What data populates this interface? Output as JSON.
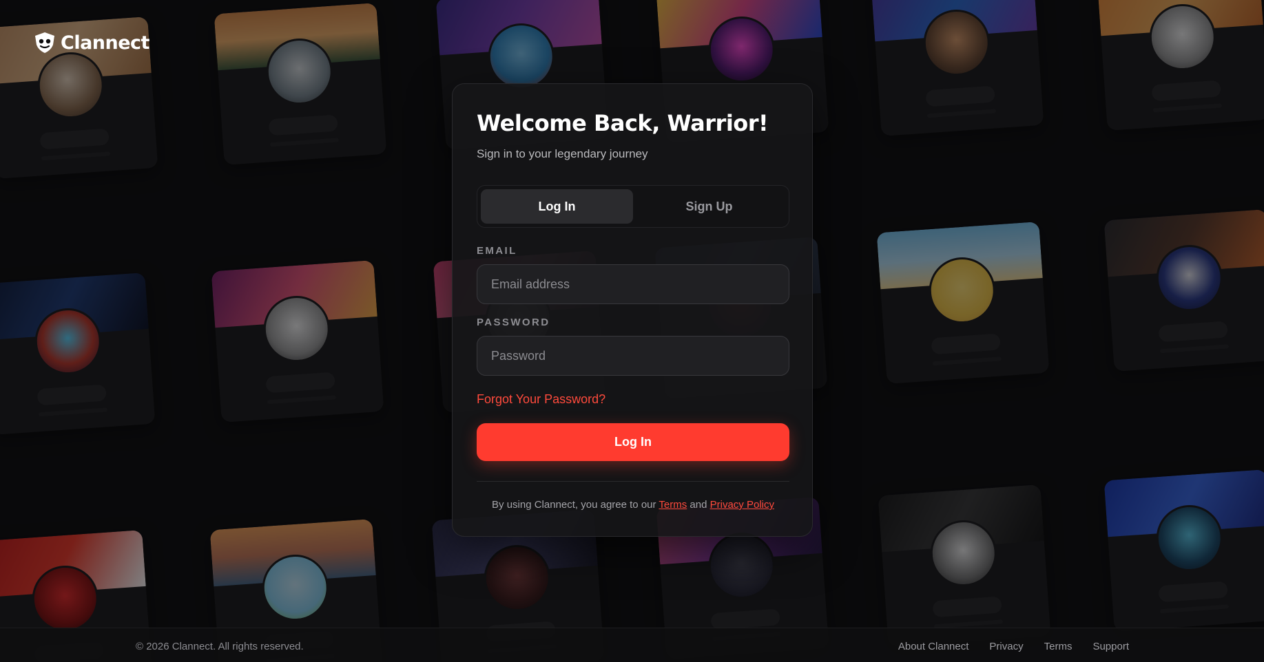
{
  "brand": {
    "name": "Clannect"
  },
  "login": {
    "title": "Welcome Back, Warrior!",
    "subtitle": "Sign in to your legendary journey",
    "tabs": [
      {
        "label": "Log In",
        "active": true
      },
      {
        "label": "Sign Up",
        "active": false
      }
    ],
    "email": {
      "label": "EMAIL",
      "placeholder": "Email address",
      "value": ""
    },
    "password": {
      "label": "PASSWORD",
      "placeholder": "Password",
      "value": ""
    },
    "forgot_link": "Forgot Your Password?",
    "submit_label": "Log In",
    "legal": {
      "prefix": "By using Clannect, you agree to our",
      "terms": "Terms",
      "conjunction": "and",
      "privacy": "Privacy Policy"
    }
  },
  "footer": {
    "copyright": "© 2026 Clannect. All rights reserved.",
    "links": [
      "About Clannect",
      "Privacy",
      "Terms",
      "Support"
    ]
  },
  "colors": {
    "accent": "#ff3b2f",
    "link": "#ff4a3c",
    "panel": "#161618",
    "background": "#0c0c0d"
  },
  "icons": {
    "logo": "clannect-shield-icon"
  }
}
